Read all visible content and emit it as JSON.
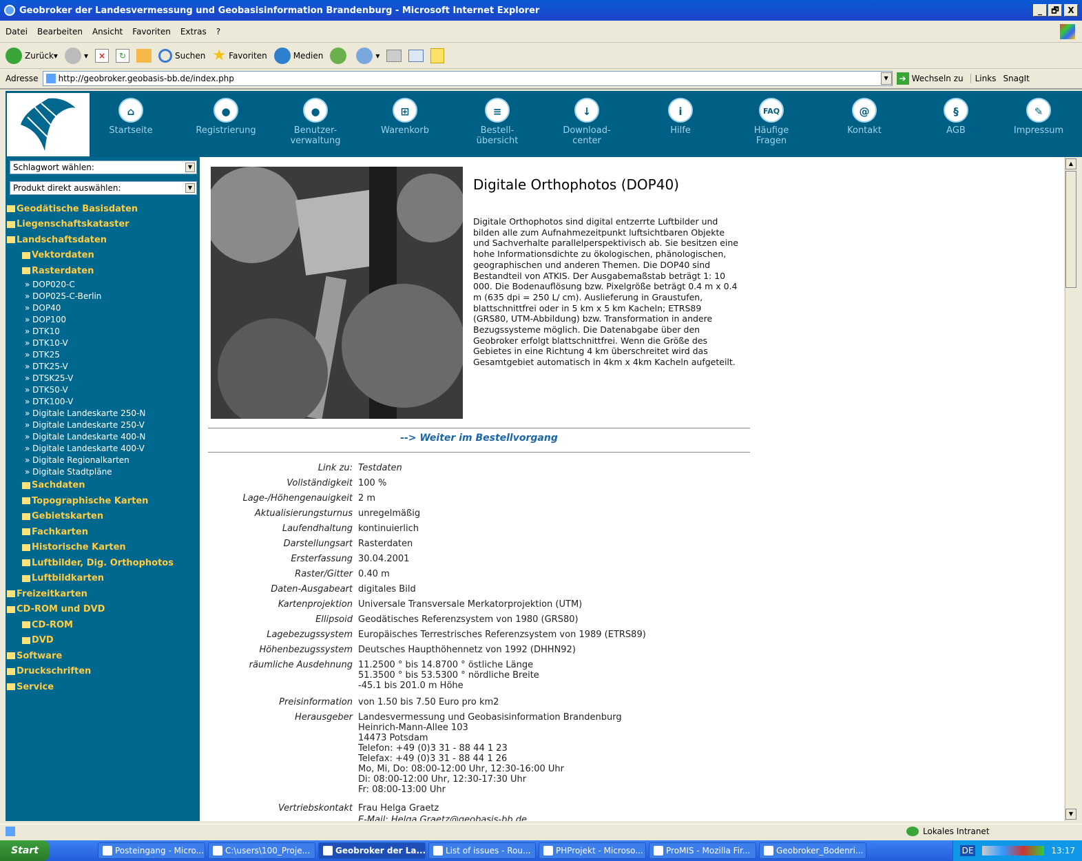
{
  "window": {
    "title": "Geobroker der Landesvermessung und Geobasisinformation Brandenburg - Microsoft Internet Explorer",
    "controls": [
      "_",
      "🗗",
      "X"
    ]
  },
  "menu": [
    "Datei",
    "Bearbeiten",
    "Ansicht",
    "Favoriten",
    "Extras",
    "?"
  ],
  "toolbar": {
    "back": "Zurück",
    "search": "Suchen",
    "favorites": "Favoriten",
    "media": "Medien"
  },
  "address": {
    "label": "Adresse",
    "url": "http://geobroker.geobasis-bb.de/index.php",
    "go": "Wechseln zu",
    "links": "Links",
    "snagit": "SnagIt"
  },
  "nav": [
    {
      "label": "Startseite",
      "icon": "home-icon",
      "glyph": "⌂"
    },
    {
      "label": "Registrierung",
      "icon": "user-icon",
      "glyph": "●"
    },
    {
      "label": "Benutzer-\nverwaltung",
      "icon": "user-admin-icon",
      "glyph": "●"
    },
    {
      "label": "Warenkorb",
      "icon": "cart-icon",
      "glyph": "⊞"
    },
    {
      "label": "Bestell-\nübersicht",
      "icon": "list-icon",
      "glyph": "≡"
    },
    {
      "label": "Download-\ncenter",
      "icon": "download-icon",
      "glyph": "↓"
    },
    {
      "label": "Hilfe",
      "icon": "info-icon",
      "glyph": "i"
    },
    {
      "label": "Häufige\nFragen",
      "icon": "faq-icon",
      "glyph": "FAQ"
    },
    {
      "label": "Kontakt",
      "icon": "at-icon",
      "glyph": "@"
    },
    {
      "label": "AGB",
      "icon": "paragraph-icon",
      "glyph": "§"
    },
    {
      "label": "Impressum",
      "icon": "pen-icon",
      "glyph": "✎"
    }
  ],
  "sidebar": {
    "select1": "Schlagwort wählen:",
    "select2": "Produkt direkt auswählen:",
    "tree": [
      {
        "label": "Geodätische Basisdaten",
        "level": 1
      },
      {
        "label": "Liegenschaftskataster",
        "level": 1
      },
      {
        "label": "Landschaftsdaten",
        "level": 1
      },
      {
        "label": "Vektordaten",
        "level": 2
      },
      {
        "label": "Rasterdaten",
        "level": 2
      },
      {
        "label": "» DOP020-C",
        "level": 3
      },
      {
        "label": "» DOP025-C-Berlin",
        "level": 3
      },
      {
        "label": "» DOP40",
        "level": 3
      },
      {
        "label": "» DOP100",
        "level": 3
      },
      {
        "label": "» DTK10",
        "level": 3
      },
      {
        "label": "» DTK10-V",
        "level": 3
      },
      {
        "label": "» DTK25",
        "level": 3
      },
      {
        "label": "» DTK25-V",
        "level": 3
      },
      {
        "label": "» DTSK25-V",
        "level": 3
      },
      {
        "label": "» DTK50-V",
        "level": 3
      },
      {
        "label": "» DTK100-V",
        "level": 3
      },
      {
        "label": "» Digitale Landeskarte 250-N",
        "level": 3
      },
      {
        "label": "» Digitale Landeskarte 250-V",
        "level": 3
      },
      {
        "label": "» Digitale Landeskarte 400-N",
        "level": 3
      },
      {
        "label": "» Digitale Landeskarte 400-V",
        "level": 3
      },
      {
        "label": "» Digitale Regionalkarten",
        "level": 3
      },
      {
        "label": "» Digitale Stadtpläne",
        "level": 3
      },
      {
        "label": "Sachdaten",
        "level": 2
      },
      {
        "label": "Topographische Karten",
        "level": 2
      },
      {
        "label": "Gebietskarten",
        "level": 2
      },
      {
        "label": "Fachkarten",
        "level": 2
      },
      {
        "label": "Historische Karten",
        "level": 2
      },
      {
        "label": "Luftbilder, Dig. Orthophotos",
        "level": 2
      },
      {
        "label": "Luftbildkarten",
        "level": 2
      },
      {
        "label": "Freizeitkarten",
        "level": 1
      },
      {
        "label": "CD-ROM und DVD",
        "level": 1
      },
      {
        "label": "CD-ROM",
        "level": 2
      },
      {
        "label": "DVD",
        "level": 2
      },
      {
        "label": "Software",
        "level": 1
      },
      {
        "label": "Druckschriften",
        "level": 1
      },
      {
        "label": "Service",
        "level": 1
      }
    ]
  },
  "product": {
    "title": "Digitale Orthophotos (DOP40)",
    "description": "Digitale Orthophotos sind digital entzerrte Luftbilder und bilden alle zum Aufnahmezeitpunkt luftsichtbaren Objekte und Sachverhalte parallelperspektivisch ab. Sie besitzen eine hohe Informationsdichte zu ökologischen, phänologischen, geographischen und anderen Themen. Die DOP40 sind Bestandteil von ATKIS. Der Ausgabemaßstab beträgt 1: 10 000. Die Bodenauflösung bzw. Pixelgröße beträgt 0.4 m x 0.4 m (635 dpi = 250 L/ cm). Auslieferung in Graustufen, blattschnittfrei oder in 5 km x 5 km Kacheln; ETRS89 (GRS80, UTM-Abbildung) bzw. Transformation in andere Bezugssysteme möglich. Die Datenabgabe über den Geobroker erfolgt blattschnittfrei. Wenn die Größe des Gebietes in eine Richtung 4 km überschreitet wird das Gesamtgebiet automatisch in 4km x 4km Kacheln aufgeteilt.",
    "continue_link": "--> Weiter im Bestellvorgang",
    "details": [
      {
        "key": "Link zu:",
        "value": "Testdaten"
      },
      {
        "key": "Vollständigkeit",
        "value": "100 %"
      },
      {
        "key": "Lage-/Höhengenauigkeit",
        "value": "2 m"
      },
      {
        "key": "Aktualisierungsturnus",
        "value": "unregelmäßig"
      },
      {
        "key": "Laufendhaltung",
        "value": "kontinuierlich"
      },
      {
        "key": "Darstellungsart",
        "value": "Rasterdaten"
      },
      {
        "key": "Ersterfassung",
        "value": "30.04.2001"
      },
      {
        "key": "Raster/Gitter",
        "value": "0.40 m"
      },
      {
        "key": "Daten-Ausgabeart",
        "value": "digitales Bild"
      },
      {
        "key": "Kartenprojektion",
        "value": "Universale Transversale Merkatorprojektion (UTM)"
      },
      {
        "key": "Ellipsoid",
        "value": "Geodätisches Referenzsystem von 1980 (GRS80)"
      },
      {
        "key": "Lagebezugssystem",
        "value": "Europäisches Terrestrisches Referenzsystem von 1989 (ETRS89)"
      },
      {
        "key": "Höhenbezugssystem",
        "value": "Deutsches Haupthöhennetz von 1992 (DHHN92)"
      },
      {
        "key": "räumliche Ausdehnung",
        "value": "11.2500 ° bis 14.8700 ° östliche Länge\n51.3500 ° bis 53.5300 ° nördliche Breite\n-45.1 bis 201.0 m Höhe"
      },
      {
        "key": "Preisinformation",
        "value": "von 1.50 bis 7.50 Euro pro km2"
      },
      {
        "key": "Herausgeber",
        "value": "Landesvermessung und Geobasisinformation Brandenburg\nHeinrich-Mann-Allee 103\n14473 Potsdam\nTelefon: +49 (0)3 31 - 88 44 1 23\nTelefax: +49 (0)3 31 - 88 44 1 26\nMo, Mi, Do: 08:00-12:00 Uhr, 12:30-16:00 Uhr\nDi: 08:00-12:00 Uhr, 12:30-17:30 Uhr\nFr: 08:00-13:00 Uhr"
      },
      {
        "key": "Vertriebskontakt",
        "value": "Frau Helga Graetz"
      }
    ],
    "email_partial": "E-Mail: Helga.Graetz@geobasis-bb.de"
  },
  "status": {
    "zone": "Lokales Intranet"
  },
  "taskbar": {
    "start": "Start",
    "tasks": [
      "Posteingang - Micro...",
      "C:\\users\\100_Proje...",
      "Geobroker der La...",
      "List of issues - Rou...",
      "PHProjekt - Microso...",
      "ProMIS - Mozilla Fir...",
      "Geobroker_Bodenri..."
    ],
    "active": 2,
    "lang": "DE",
    "clock": "13:17"
  }
}
